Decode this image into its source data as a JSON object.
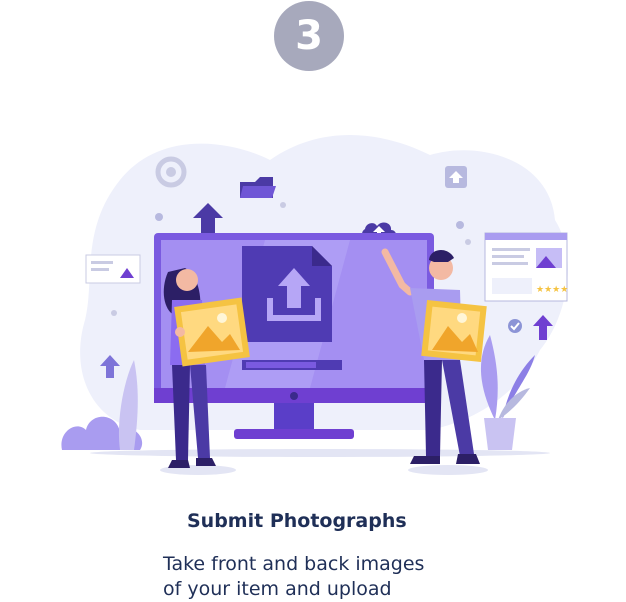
{
  "step": {
    "number": "3",
    "title": "Submit Photographs",
    "description_lines": [
      "Take front and back images",
      "of your item and upload"
    ]
  },
  "illustration": {
    "icons": [
      "gear-icon",
      "folder-icon",
      "upload-arrow-icon",
      "cloud-upload-icon",
      "photo-card-icon",
      "check-icon",
      "stars-rating-icon",
      "file-upload-icon",
      "monitor-icon",
      "person-holding-photo-left",
      "person-holding-photo-right",
      "plant-icon",
      "bush-icon"
    ],
    "colors": {
      "badge": "#a7a9bc",
      "primary_purple": "#6f3fd1",
      "light_purple": "#a99cf0",
      "dark_purple": "#3b2a8c",
      "blob_bg": "#eef0fb",
      "photo_yellow": "#f5c342",
      "text_navy": "#1f2f57"
    }
  }
}
